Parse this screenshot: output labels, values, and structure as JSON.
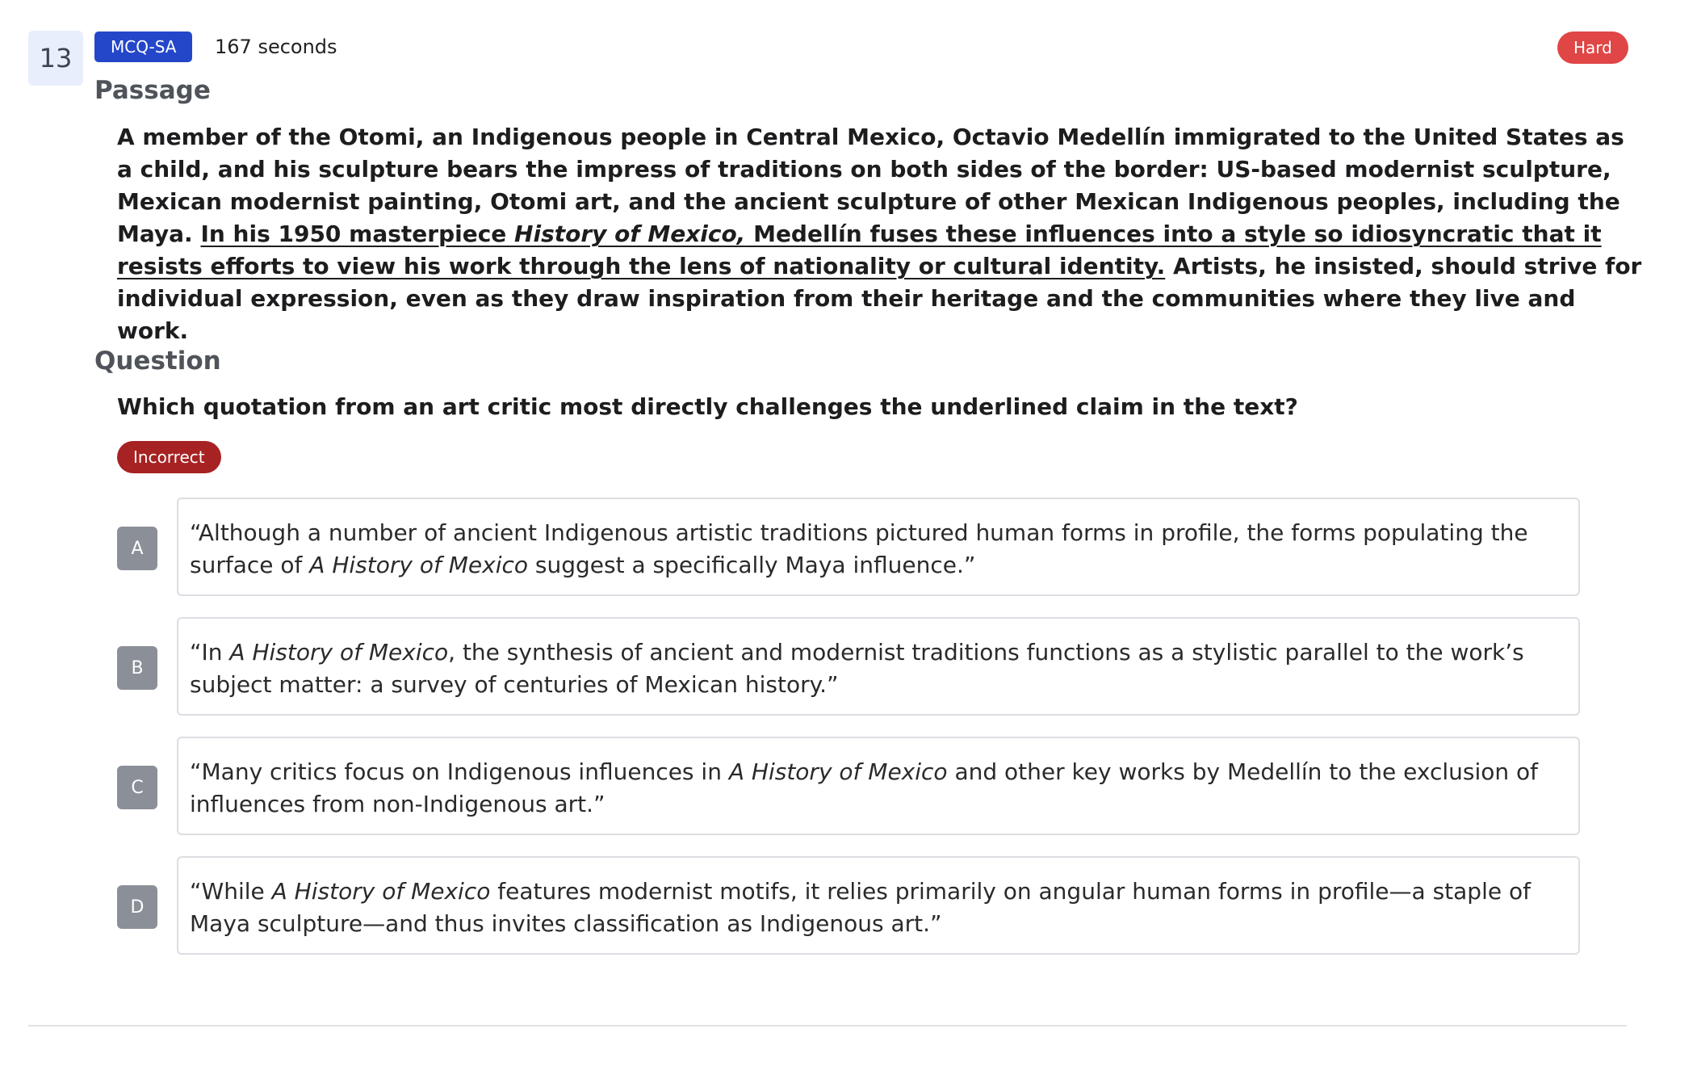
{
  "question": {
    "number": "13",
    "type_badge": "MCQ-SA",
    "time": "167 seconds",
    "difficulty": "Hard",
    "status": "Incorrect"
  },
  "passage": {
    "heading": "Passage",
    "p1": "A member of the Otomi, an Indigenous people in Central Mexico, Octavio Medellín immigrated to the United States as a child, and his sculpture bears the impress of traditions on both sides of the border: US-based modernist sculpture, Mexican modernist painting, Otomi art, and the ancient sculpture of other Mexican Indigenous peoples, including the Maya. ",
    "u1": "In his 1950 masterpiece ",
    "u_italic": "History of Mexico,",
    "u2": " Medellín fuses these influences into a style so idiosyncratic that it resists efforts to view his work through the lens of nationality or cultural identity.",
    "p2": " Artists, he insisted, should strive for individual expression, even as they draw inspiration from their heritage and the communities where they live and work."
  },
  "prompt": {
    "heading": "Question",
    "text": "Which quotation from an art critic most directly challenges the underlined claim in the text?"
  },
  "options": [
    {
      "letter": "A",
      "t1": "“Although a number of ancient Indigenous artistic traditions pictured human forms in profile, the forms populating the surface of ",
      "i1": "A History of Mexico",
      "t2": " suggest a specifically Maya influence.”"
    },
    {
      "letter": "B",
      "t1": "“In ",
      "i1": "A History of Mexico",
      "t2": ", the synthesis of ancient and modernist traditions functions as a stylistic parallel to the work’s subject matter: a survey of centuries of Mexican history.”"
    },
    {
      "letter": "C",
      "t1": "“Many critics focus on Indigenous influences in ",
      "i1": "A History of Mexico",
      "t2": " and other key works by Medellín to the exclusion of influences from non-Indigenous art.”"
    },
    {
      "letter": "D",
      "t1": "“While ",
      "i1": "A History of Mexico",
      "t2": " features modernist motifs, it relies primarily on angular human forms in profile—a staple of Maya sculpture—and thus invites classification as Indigenous art.”"
    }
  ],
  "colors": {
    "type_badge": "#2447c9",
    "difficulty_badge": "#e04646",
    "status_badge": "#a72222",
    "option_letter": "#8b8f98",
    "number_box": "#e8eefb"
  }
}
